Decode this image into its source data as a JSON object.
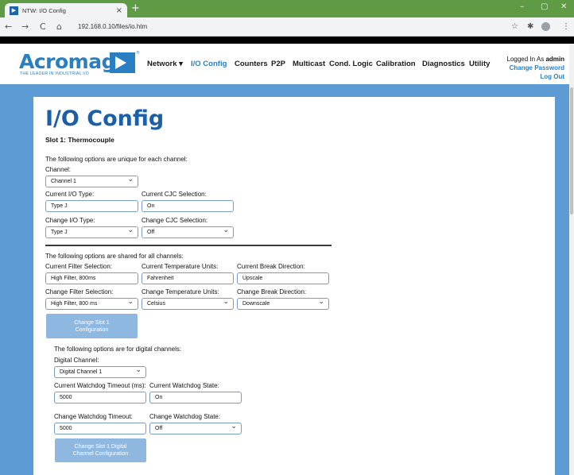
{
  "browser": {
    "tab_title": "NTW: I/O Config",
    "tab_close": "×",
    "new_tab": "+",
    "url": "192.168.0.10/files/io.htm",
    "minimize": "–",
    "maximize": "▢",
    "close": "✕",
    "back": "←",
    "forward": "→",
    "reload": "C",
    "home": "⌂",
    "star": "☆",
    "extensions": "✱",
    "menu": "⋮"
  },
  "header": {
    "logo_text": "Acromag",
    "logo_reg": "®",
    "logo_tagline": "THE LEADER IN INDUSTRIAL I/O",
    "nav": [
      "Network ▾",
      "I/O Config",
      "Counters",
      "P2P",
      "Multicast",
      "Cond. Logic",
      "Calibration",
      "Diagnostics",
      "Utility"
    ],
    "logged_in_prefix": "Logged In As ",
    "logged_in_user": "admin",
    "change_password": "Change Password",
    "log_out": "Log Out"
  },
  "page": {
    "title": "I/O Config",
    "slot_title": "Slot 1: Thermocouple",
    "unique_heading": "The following options are unique for each channel:",
    "channel_label": "Channel:",
    "channel_value": "Channel 1",
    "current_io_type_label": "Current I/O Type:",
    "current_io_type_value": "Type J",
    "current_cjc_label": "Current CJC Selection:",
    "current_cjc_value": "On",
    "change_io_type_label": "Change I/O Type:",
    "change_io_type_value": "Type J",
    "change_cjc_label": "Change CJC Selection:",
    "change_cjc_value": "Off",
    "shared_heading": "The following options are shared for all channels:",
    "current_filter_label": "Current Filter Selection:",
    "current_filter_value": "High Filter, 800ms",
    "current_temp_units_label": "Current Temperature Units:",
    "current_temp_units_value": "Fahrenheit",
    "current_break_label": "Current Break Direction:",
    "current_break_value": "Upscale",
    "change_filter_label": "Change Filter Selection:",
    "change_filter_value": "High Filter, 800 ms",
    "change_temp_units_label": "Change Temperature Units:",
    "change_temp_units_value": "Celsius",
    "change_break_label": "Change Break Direction:",
    "change_break_value": "Downscale",
    "change_slot_btn_line1": "Change Slot 1",
    "change_slot_btn_line2": "Configuration",
    "digital_heading": "The following options are for digital channels:",
    "digital_channel_label": "Digital Channel:",
    "digital_channel_value": "Digital Channel 1",
    "current_wd_timeout_label": "Current Watchdog Timeout (ms):",
    "current_wd_timeout_value": "5000",
    "current_wd_state_label": "Current Watchdog State:",
    "current_wd_state_value": "On",
    "change_wd_timeout_label": "Change Watchdog Timeout:",
    "change_wd_timeout_value": "5000",
    "change_wd_state_label": "Change Watchdog State:",
    "change_wd_state_value": "Off",
    "change_digital_btn_line1": "Change Slot 1 Digital",
    "change_digital_btn_line2": "Channel Configuration"
  },
  "colors": {
    "brand_blue": "#2a7fc2",
    "page_background": "#5d9bd5",
    "button_disabled": "#8eb8e0",
    "titlebar_green": "#5f9a45"
  }
}
